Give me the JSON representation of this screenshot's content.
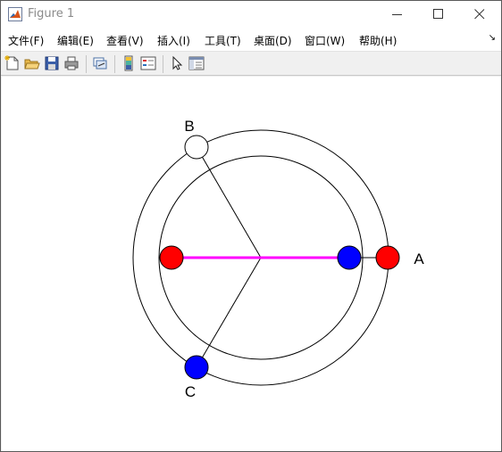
{
  "window": {
    "title": "Figure 1",
    "accent": "#d95319"
  },
  "menubar": {
    "items": [
      {
        "label": "文件(F)"
      },
      {
        "label": "编辑(E)"
      },
      {
        "label": "查看(V)"
      },
      {
        "label": "插入(I)"
      },
      {
        "label": "工具(T)"
      },
      {
        "label": "桌面(D)"
      },
      {
        "label": "窗口(W)"
      },
      {
        "label": "帮助(H)"
      }
    ],
    "overflow_icon": "overflow-arrow-icon"
  },
  "toolbar": {
    "icons": [
      "new-figure-icon",
      "open-file-icon",
      "save-icon",
      "print-icon",
      "link-plot-icon",
      "insert-colorbar-icon",
      "insert-legend-icon",
      "pointer-icon",
      "property-editor-icon"
    ]
  },
  "figure": {
    "labels": {
      "a": "A",
      "b": "B",
      "c": "C"
    },
    "colors": {
      "red": "#ff0000",
      "blue": "#0000ff",
      "magenta": "#ff00ff",
      "line": "#000000"
    }
  }
}
